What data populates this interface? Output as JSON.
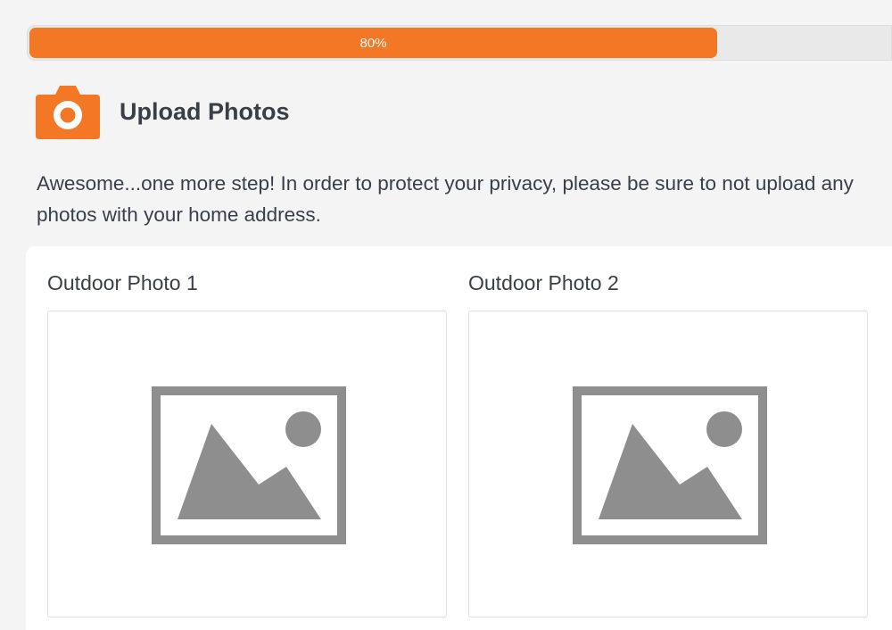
{
  "progress": {
    "percent": 80,
    "label": "80%"
  },
  "header": {
    "icon": "camera-icon",
    "title": "Upload Photos"
  },
  "intro": {
    "text": "Awesome...one more step! In order to protect your privacy, please be sure to not upload any photos with your home address."
  },
  "uploads": [
    {
      "label": "Outdoor Photo 1",
      "icon": "image-placeholder-icon"
    },
    {
      "label": "Outdoor Photo 2",
      "icon": "image-placeholder-icon"
    }
  ],
  "colors": {
    "accent": "#f47725",
    "page_background": "#f4f4f4",
    "text": "#3a3f47",
    "placeholder_gray": "#8e8e8e"
  }
}
